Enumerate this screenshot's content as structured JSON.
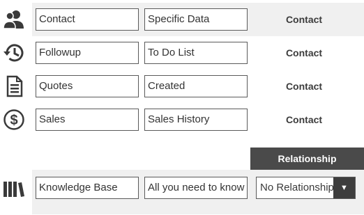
{
  "rows": [
    {
      "icon": "contact-icon",
      "field1": "Contact",
      "field2": "Specific Data",
      "label": "Contact"
    },
    {
      "icon": "history-icon",
      "field1": "Followup",
      "field2": "To Do List",
      "label": "Contact"
    },
    {
      "icon": "document-icon",
      "field1": "Quotes",
      "field2": "Created",
      "label": "Contact"
    },
    {
      "icon": "dollar-icon",
      "field1": "Sales",
      "field2": "Sales History",
      "label": "Contact"
    }
  ],
  "knowledge": {
    "icon": "books-icon",
    "field1": "Knowledge Base",
    "field2": "All you need to know"
  },
  "relationship": {
    "header": "Relationship",
    "selected": "No Relationship",
    "caret_glyph": "▼"
  }
}
